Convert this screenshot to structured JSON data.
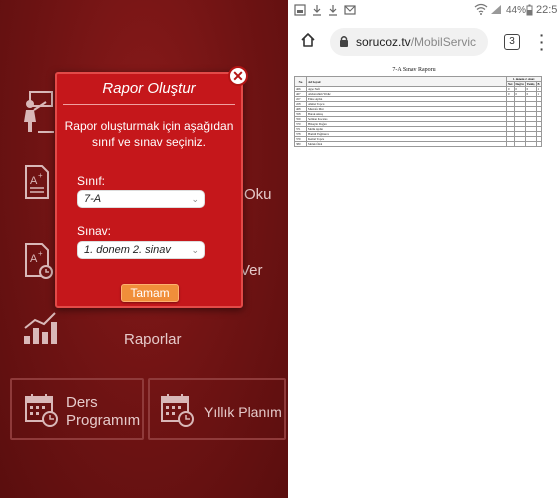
{
  "app": {
    "tiles": [
      {
        "id": "t1",
        "label": ""
      },
      {
        "id": "t2",
        "label": "Oku"
      },
      {
        "id": "t3",
        "label": "Ver"
      },
      {
        "id": "t4",
        "label": "Raporlar"
      },
      {
        "id": "t5",
        "label": "Ders\nProgramım"
      },
      {
        "id": "t6",
        "label": "Yıllık Planım"
      }
    ],
    "dialog": {
      "title": "Rapor Oluştur",
      "message": "Rapor oluşturmak için aşağıdan sınıf ve sınav seçiniz.",
      "class_label": "Sınıf:",
      "class_value": "7-A",
      "exam_label": "Sınav:",
      "exam_value": "1. donem 2. sinav",
      "ok_label": "Tamam",
      "close_label": "✕"
    }
  },
  "browser": {
    "status": {
      "battery": "44%",
      "time": "22:5"
    },
    "url_host": "sorucoz.tv",
    "url_path": "/MobilServic",
    "tab_count": "3",
    "report": {
      "title": "7-A Sınav Raporu",
      "headers": [
        "No",
        "Ad Soyad",
        "1. donem 2. sinav"
      ],
      "subheaders": [
        "Net",
        "Doğru",
        "Yanlış",
        "B"
      ],
      "rows": [
        {
          "no": "466",
          "name": "Ayşe Nefi",
          "vals": [
            "0",
            "0",
            "0",
            "1"
          ]
        },
        {
          "no": "467",
          "name": "Abdurrahim Yildiz",
          "vals": [
            "0",
            "0",
            "0",
            "1"
          ]
        },
        {
          "no": "457",
          "name": "Emre Aydın",
          "vals": [
            "",
            "",
            "",
            ""
          ]
        },
        {
          "no": "458",
          "name": "Ahmet Topcu",
          "vals": [
            "",
            "",
            "",
            ""
          ]
        },
        {
          "no": "468",
          "name": "Mustafa Mut",
          "vals": [
            "",
            "",
            "",
            ""
          ]
        },
        {
          "no": "358",
          "name": "Burak Aktaş",
          "vals": [
            "",
            "",
            "",
            ""
          ]
        },
        {
          "no": "359",
          "name": "Selman Kocatas",
          "vals": [
            "",
            "",
            "",
            ""
          ]
        },
        {
          "no": "370",
          "name": "Hüseyin Doğan",
          "vals": [
            "",
            "",
            "",
            ""
          ]
        },
        {
          "no": "371",
          "name": "Melik Aydın",
          "vals": [
            "",
            "",
            "",
            ""
          ]
        },
        {
          "no": "378",
          "name": "Hamdi Yağmurca",
          "vals": [
            "",
            "",
            "",
            ""
          ]
        },
        {
          "no": "379",
          "name": "Kemal Topcu",
          "vals": [
            "",
            "",
            "",
            ""
          ]
        },
        {
          "no": "380",
          "name": "Melek Önal",
          "vals": [
            "",
            "",
            "",
            ""
          ]
        }
      ]
    }
  },
  "colors": {
    "app_bg": "#6e1313",
    "dialog_bg": "#c5171b",
    "ok_button": "#f08e3a"
  },
  "icons": {
    "t1": "teacher-board-icon",
    "t2": "document-grade-icon",
    "t3": "document-clock-icon",
    "t4": "bar-chart-icon",
    "t5": "calendar-clock-icon",
    "t6": "calendar-clock-icon"
  }
}
